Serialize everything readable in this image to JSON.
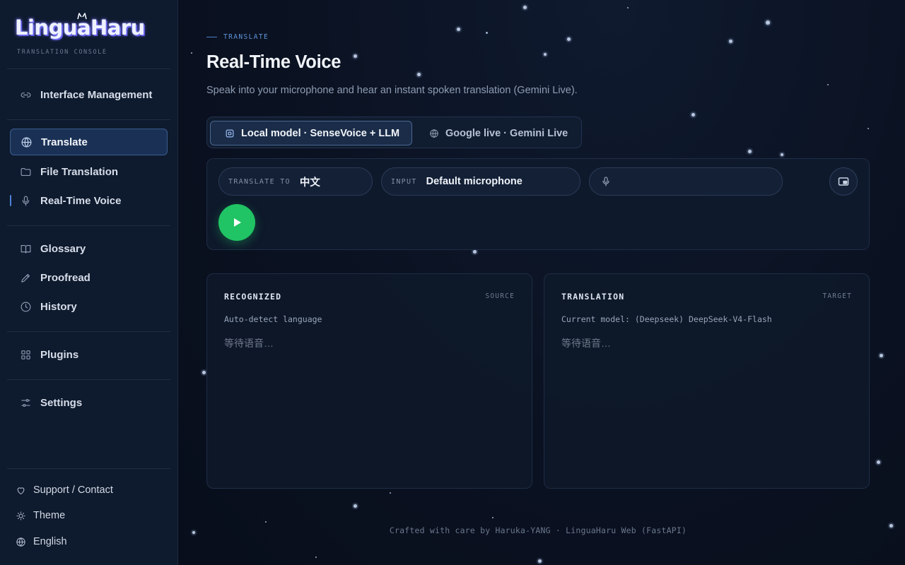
{
  "brand": {
    "name": "LinguaHaru",
    "subtitle": "TRANSLATION CONSOLE"
  },
  "sidebar": {
    "items": [
      {
        "label": "Interface Management",
        "icon": "link-icon"
      },
      {
        "label": "Translate",
        "icon": "globe-icon",
        "active": true
      },
      {
        "label": "File Translation",
        "icon": "folder-icon"
      },
      {
        "label": "Real-Time Voice",
        "icon": "microphone-icon",
        "current": true
      },
      {
        "label": "Glossary",
        "icon": "book-icon"
      },
      {
        "label": "Proofread",
        "icon": "pen-icon"
      },
      {
        "label": "History",
        "icon": "clock-icon"
      },
      {
        "label": "Plugins",
        "icon": "grid-icon"
      },
      {
        "label": "Settings",
        "icon": "sliders-icon"
      }
    ],
    "footer": {
      "support": "Support / Contact",
      "theme": "Theme",
      "language": "English"
    }
  },
  "page": {
    "eyebrow": "TRANSLATE",
    "title": "Real-Time Voice",
    "subtitle": "Speak into your microphone and hear an instant spoken translation (Gemini Live)."
  },
  "mode_tabs": [
    {
      "label": "Local model · SenseVoice + LLM",
      "selected": true
    },
    {
      "label": "Google live · Gemini Live",
      "selected": false
    }
  ],
  "controls": {
    "translate_to_label": "TRANSLATE TO",
    "translate_to_value": "中文",
    "input_label": "INPUT",
    "input_value": "Default microphone",
    "mic_level_value": ""
  },
  "panels": {
    "recognized": {
      "title": "RECOGNIZED",
      "tag": "SOURCE",
      "meta": "Auto-detect language",
      "placeholder": "等待语音…"
    },
    "translation": {
      "title": "TRANSLATION",
      "tag": "TARGET",
      "meta": "Current model: (Deepseek) DeepSeek-V4-Flash",
      "placeholder": "等待语音…"
    }
  },
  "footer": {
    "text": "Crafted with care by Haruka-YANG · LinguaHaru Web (FastAPI)"
  },
  "colors": {
    "accent": "#4c82d8",
    "play": "#20c464",
    "background": "#0a1120",
    "sidebar": "#0e1a2d"
  }
}
